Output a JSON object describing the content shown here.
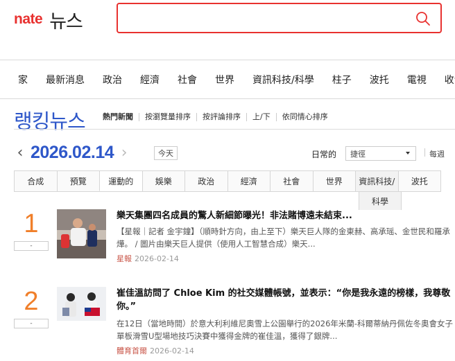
{
  "header": {
    "brand": "nate",
    "section": "뉴스",
    "search_placeholder": ""
  },
  "main_nav": [
    "家",
    "最新消息",
    "政治",
    "經濟",
    "社會",
    "世界",
    "資訊科技/科學",
    "柱子",
    "波托",
    "電視",
    "收音"
  ],
  "ranking": {
    "title": "랭킹뉴스",
    "tabs": [
      "熱門新聞",
      "按瀏覽量排序",
      "按評論排序",
      "上/下",
      "依同情心排序"
    ]
  },
  "date_bar": {
    "date": "2026.02.14",
    "today": "今天",
    "period_label": "日常的",
    "period_value": "捷徑",
    "every": "每週"
  },
  "categories": [
    "合成",
    "預覽",
    "運動的",
    "娛樂",
    "政治",
    "經濟",
    "社會",
    "世界",
    "資訊科技/",
    "波托"
  ],
  "category_overflow": "科學",
  "articles": [
    {
      "rank": "1",
      "badge": "-",
      "title": "樂天集團四名成員的驚人新細節曝光！非法賭博遠未結束...",
      "body": "【星報｜記者 金宇鐘】（順時針方向，由上至下）樂天巨人隊的金東赫、高承瑶、金世民和羅承燁。 / 圖片由樂天巨人提供（使用人工智慧合成）樂天...",
      "source": "星報",
      "date": "2026-02-14"
    },
    {
      "rank": "2",
      "badge": "-",
      "title": "崔佳溫訪問了 Chloe Kim 的社交媒體帳號，並表示：“你是我永遠的榜樣，我尊敬你。”",
      "body": "在12日（當地時間）於意大利利維尼奧雪上公園舉行的2026年米蘭-科爾蒂納丹佩佐冬奧會女子單板滑雪U型場地技巧決賽中獲得金牌的崔佳溫，獲得了銀牌...",
      "source": "體育首爾",
      "date": "2026-02-14"
    }
  ],
  "colors": {
    "brand_red": "#e8312f",
    "accent_blue": "#2e57c9",
    "rank_orange": "#f07f2a"
  }
}
